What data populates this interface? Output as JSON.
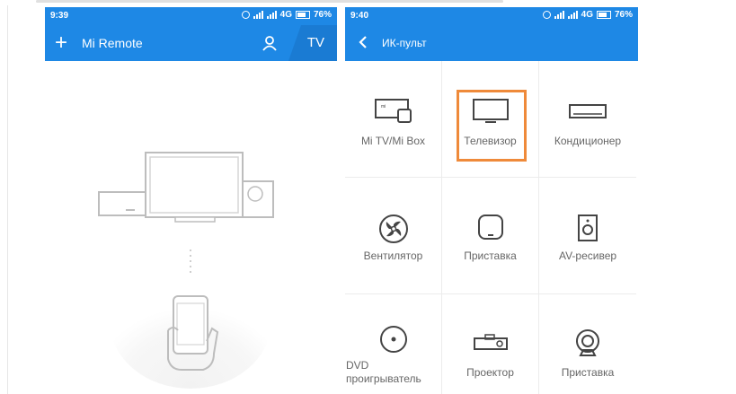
{
  "left_screen": {
    "status": {
      "time": "9:39",
      "network": "4G",
      "battery": "76%"
    },
    "appbar": {
      "title": "Mi Remote",
      "tab": "TV"
    }
  },
  "right_screen": {
    "status": {
      "time": "9:40",
      "network": "4G",
      "battery": "76%"
    },
    "appbar": {
      "title": "ИК-пульт"
    },
    "devices": [
      {
        "label": "Mi TV/Mi Box",
        "icon": "mi-tv-box-icon"
      },
      {
        "label": "Телевизор",
        "icon": "tv-icon",
        "highlighted": true
      },
      {
        "label": "Кондиционер",
        "icon": "air-conditioner-icon"
      },
      {
        "label": "Вентилятор",
        "icon": "fan-icon"
      },
      {
        "label": "Приставка",
        "icon": "set-top-box-icon"
      },
      {
        "label": "AV-ресивер",
        "icon": "speaker-icon"
      },
      {
        "label": "DVD\nпроигрыватель",
        "icon": "dvd-icon"
      },
      {
        "label": "Проектор",
        "icon": "projector-icon"
      },
      {
        "label": "Приставка",
        "icon": "camera-icon"
      }
    ]
  },
  "colors": {
    "brand": "#1e88e5",
    "highlight": "#ef8a3a"
  }
}
